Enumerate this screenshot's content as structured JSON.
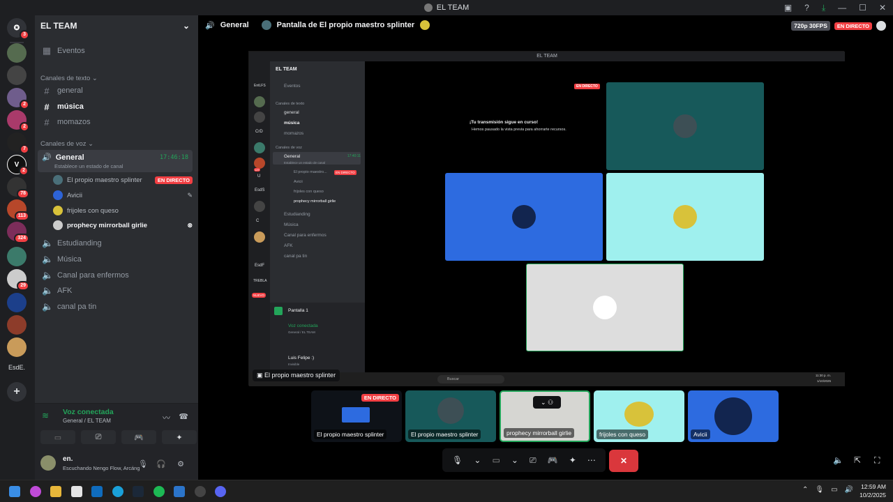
{
  "titlebar": {
    "title": "EL TEAM"
  },
  "servers": {
    "badges": [
      "3",
      "2",
      "2",
      "7",
      "2",
      "78",
      "113",
      "324",
      "29"
    ],
    "last_label": "EsdE."
  },
  "sidebar": {
    "server_name": "EL TEAM",
    "events": "Eventos",
    "text_category": "Canales de texto",
    "text_channels": [
      "general",
      "música",
      "momazos"
    ],
    "voice_category": "Canales de voz",
    "general": {
      "name": "General",
      "time": "17:46:18",
      "status": "Establece un estado de canal"
    },
    "voice_users": [
      {
        "name": "El propio maestro splinter",
        "live": "EN DIRECTO"
      },
      {
        "name": "Avicii"
      },
      {
        "name": "frijoles con queso"
      },
      {
        "name": "prophecy mirrorball girlie"
      }
    ],
    "voice_channels": [
      "Estudianding",
      "Música",
      "Canal para enfermos",
      "AFK",
      "canal pa tin"
    ]
  },
  "voice_panel": {
    "title": "Voz conectada",
    "subtitle": "General / EL TEAM",
    "user": "en.",
    "activity": "Escuchando Nengo Flow, Arcángel +1"
  },
  "stage": {
    "channel": "General",
    "title": "Pantalla de El propio maestro splinter",
    "quality": "720p 30FPS",
    "live": "EN DIRECTO"
  },
  "shared": {
    "window_title": "EL TEAM",
    "server_name": "EL TEAM",
    "events": "Eventos",
    "text_category": "Canales de texto",
    "text_channels": [
      "general",
      "música",
      "momazos"
    ],
    "voice_category": "Canales de voz",
    "general": "General",
    "time": "17:40:11",
    "status": "Establece un estado de canal",
    "users": [
      "El propio maestro...",
      "Avicii",
      "frijoles con queso",
      "prophecy mirrorball girlie"
    ],
    "voice_channels": [
      "Estudianding",
      "Música",
      "Canal para enfermos",
      "AFK",
      "canal pa tin"
    ],
    "server_labels": [
      "EntLFS",
      "CrD",
      "U",
      "EsdS",
      "C",
      "EsdF",
      "TREBLA"
    ],
    "server_badge": "129",
    "new_label": "NUEVO",
    "screen": "Pantalla 1",
    "voice_connected": "Voz conectada",
    "voice_sub": "General / EL TEAM",
    "user": "Luis Felipe :)",
    "user_status": "Invisible",
    "live": "EN DIRECTO",
    "msg_title": "¡Tu transmisión sigue en curso!",
    "msg_sub": "Hemos pausado la vista previa para ahorrarte recursos.",
    "search": "Buscar",
    "time_small": "11:30 p. m.",
    "date_small": "1/10/2025"
  },
  "tooltip": "El propio maestro splinter",
  "thumbs": [
    {
      "label": "El propio maestro splinter",
      "live": "EN DIRECTO"
    },
    {
      "label": "El propio maestro splinter"
    },
    {
      "label": "prophecy mirrorball girlie"
    },
    {
      "label": "frijoles con queso"
    },
    {
      "label": "Avicii"
    }
  ],
  "clock": {
    "time": "12:59 AM",
    "date": "10/2/2025"
  }
}
